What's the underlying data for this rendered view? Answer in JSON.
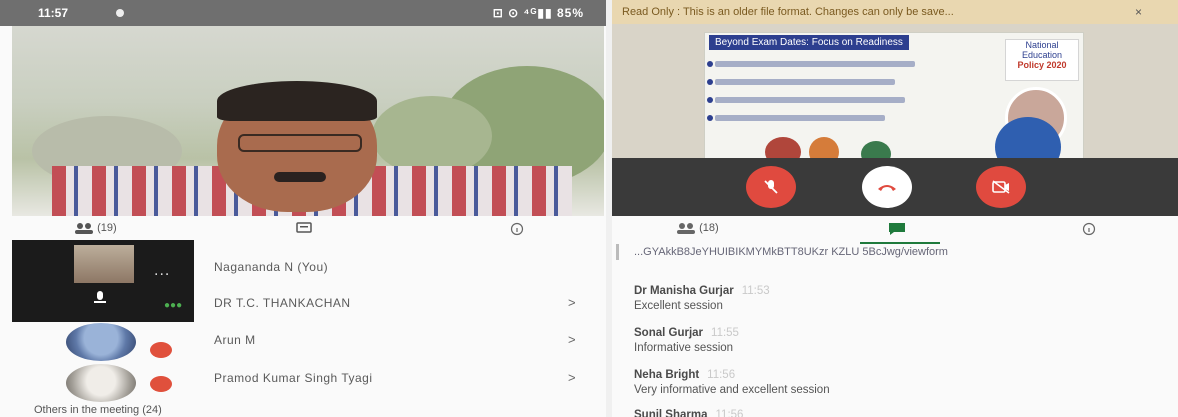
{
  "left": {
    "status": {
      "time": "11:57",
      "right": "⊡ ⊙ ⁴ᴳ▮▮ 85%"
    },
    "tabs": [
      {
        "label": "(19)"
      },
      {
        "label": ""
      },
      {
        "label": ""
      }
    ],
    "self_menu": "...",
    "participants": [
      {
        "name": "Nagananda N (You)"
      },
      {
        "name": "DR T.C. THANKACHAN"
      },
      {
        "name": "Arun M"
      },
      {
        "name": "Pramod Kumar Singh Tyagi"
      }
    ],
    "others_label": "Others in the meeting (24)"
  },
  "right": {
    "banner": "Read Only : This is an older file format. Changes can only be save...",
    "banner_close": "×",
    "slide": {
      "title": "Beyond Exam Dates: Focus on Readiness",
      "badge_line1": "National Education",
      "badge_line2": "Policy 2020"
    },
    "tabs": [
      {
        "label": "(18)"
      },
      {
        "label": ""
      },
      {
        "label": ""
      }
    ],
    "chat_link": "...GYAkkB8JeYHUIBIKMYMkBTT8UKzr KZLU 5BcJwg/viewform",
    "messages": [
      {
        "author": "Dr Manisha Gurjar",
        "time": "11:53",
        "text": "Excellent session"
      },
      {
        "author": "Sonal Gurjar",
        "time": "11:55",
        "text": "Informative session"
      },
      {
        "author": "Neha Bright",
        "time": "11:56",
        "text": "Very informative and excellent session"
      },
      {
        "author": "Sunil Sharma",
        "time": "11:56",
        "text": ""
      }
    ]
  },
  "colors": {
    "accent_red": "#e04a3f",
    "callbar": "#3a3a3a",
    "banner_bg": "#e9d7b0"
  }
}
